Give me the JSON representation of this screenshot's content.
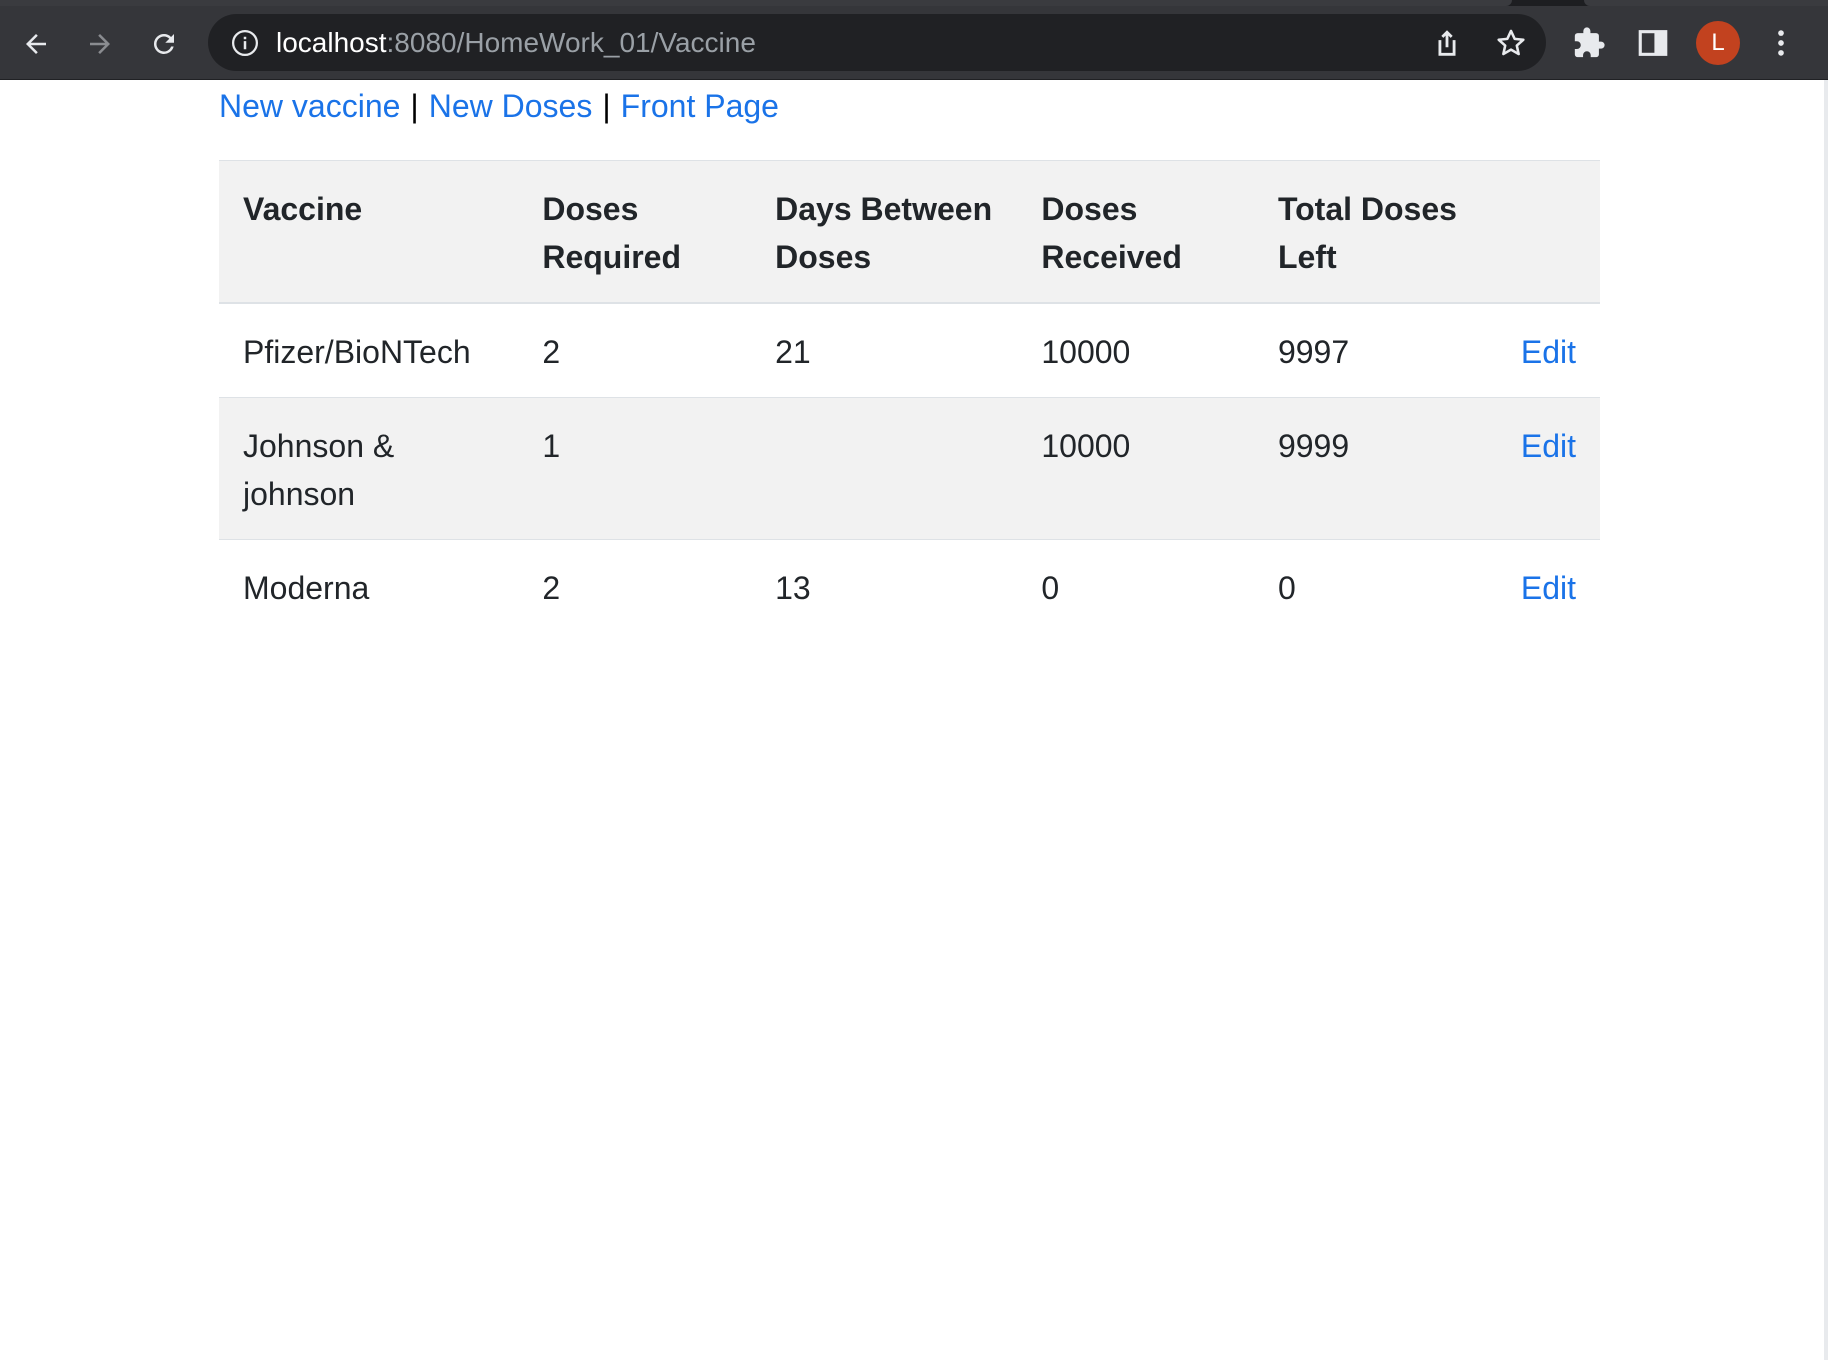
{
  "browser": {
    "url_host": "localhost",
    "url_path": ":8080/HomeWork_01/Vaccine",
    "profile_initial": "L",
    "profile_color": "#c2421f"
  },
  "nav": {
    "links": [
      "New vaccine",
      "New Doses",
      "Front Page"
    ],
    "separator": "|"
  },
  "table": {
    "headers": [
      "Vaccine",
      "Doses Required",
      "Days Between Doses",
      "Doses Received",
      "Total Doses Left"
    ],
    "rows": [
      {
        "vaccine": "Pfizer/BioNTech",
        "doses_required": "2",
        "days_between": "21",
        "doses_received": "10000",
        "doses_left": "9997",
        "action": "Edit"
      },
      {
        "vaccine": "Johnson & johnson",
        "doses_required": "1",
        "days_between": "",
        "doses_received": "10000",
        "doses_left": "9999",
        "action": "Edit"
      },
      {
        "vaccine": "Moderna",
        "doses_required": "2",
        "days_between": "13",
        "doses_received": "0",
        "doses_left": "0",
        "action": "Edit"
      }
    ]
  },
  "colors": {
    "link": "#1a73e8",
    "header_bg": "#f2f2f2",
    "toolbar_bg": "#35363a",
    "omnibox_bg": "#202124"
  }
}
